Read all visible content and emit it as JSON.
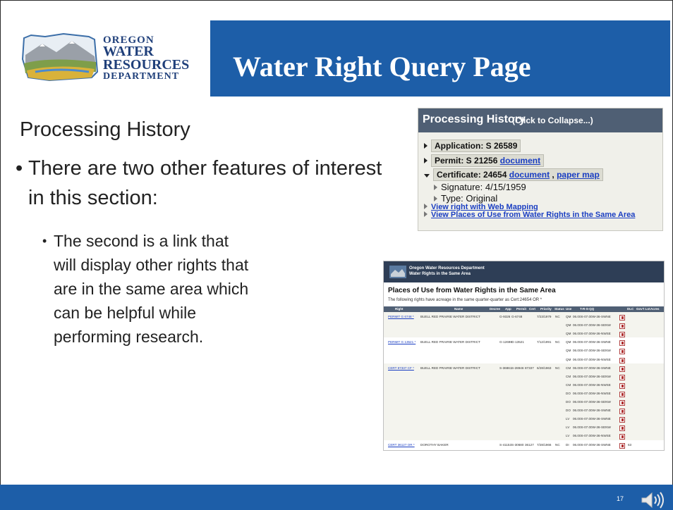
{
  "logo": {
    "line1": "OREGON",
    "line2": "WATER",
    "line3": "RESOURCES",
    "line4": "DEPARTMENT"
  },
  "header": {
    "title": "Water Right Query Page"
  },
  "content": {
    "section_title": "Processing History",
    "bullet1": "There are two other features of interest in this section:",
    "bullet2": "The second is a link that will display other rights that are in the same area which can be helpful while performing research."
  },
  "processing_history": {
    "title": "Processing History",
    "collapse": "(Click to Collapse...)",
    "application": "Application: S 26589",
    "permit": "Permit: S 21256",
    "document_link": "document",
    "certificate": "Certificate: 24654",
    "paper_map_link": "paper map",
    "signature": "Signature: 4/15/1959",
    "type": "Type: Original",
    "web_mapping_link": "View right with Web Mapping",
    "places_link": "View Places of Use from Water Rights in the Same Area"
  },
  "places": {
    "dept_line1": "Oregon Water Resources Department",
    "dept_line2": "Water Rights in the Same Area",
    "title": "Places of Use from Water Rights in the Same Area",
    "subtitle": "The following rights have acreage in the same quarter-quarter as Cert:24654 OR *",
    "columns": [
      "Right",
      "Name",
      "Decree",
      "App",
      "Permit",
      "Cert",
      "Priority",
      "Status",
      "Use",
      "T-R-S-QQ",
      "DLC",
      "Gov't Lot",
      "Acres"
    ],
    "rows": [
      {
        "right": "PERMIT G 6748 *",
        "name": "BUELL RED PRAIRIE WATER DISTRICT",
        "app": "G-9326",
        "permit": "G-6748",
        "cert": "",
        "priority": "7/23/1979",
        "status": "NC",
        "use": "QM",
        "trs": "06.00S-07.00W-36-SWNE",
        "acres": ""
      },
      {
        "right": "",
        "name": "",
        "app": "",
        "permit": "",
        "cert": "",
        "priority": "",
        "status": "",
        "use": "QM",
        "trs": "06.00S-07.00W-36-SENW",
        "acres": ""
      },
      {
        "right": "",
        "name": "",
        "app": "",
        "permit": "",
        "cert": "",
        "priority": "",
        "status": "",
        "use": "QM",
        "trs": "06.00S-07.00W-36-NWSE",
        "acres": ""
      },
      {
        "right": "PERMIT G 13521 *",
        "name": "BUELL RED PRAIRIE WATER DISTRICT",
        "app": "G-12698",
        "permit": "G-13521",
        "cert": "",
        "priority": "7/12/1991",
        "status": "NC",
        "use": "QM",
        "trs": "06.00S-07.00W-36-SWNE",
        "acres": ""
      },
      {
        "right": "",
        "name": "",
        "app": "",
        "permit": "",
        "cert": "",
        "priority": "",
        "status": "",
        "use": "QM",
        "trs": "06.00S-07.00W-36-SENW",
        "acres": ""
      },
      {
        "right": "",
        "name": "",
        "app": "",
        "permit": "",
        "cert": "",
        "priority": "",
        "status": "",
        "use": "QM",
        "trs": "06.00S-07.00W-36-NWSE",
        "acres": ""
      },
      {
        "right": "CERT 87337 CF *",
        "name": "BUELL RED PRAIRIE WATER DISTRICT",
        "app": "S-36861",
        "permit": "S-28946",
        "cert": "87337",
        "priority": "6/28/1963",
        "status": "NC",
        "use": "CM",
        "trs": "06.00S-07.00W-36-SWNE",
        "acres": ""
      },
      {
        "right": "",
        "name": "",
        "app": "",
        "permit": "",
        "cert": "",
        "priority": "",
        "status": "",
        "use": "CM",
        "trs": "06.00S-07.00W-36-SENW",
        "acres": ""
      },
      {
        "right": "",
        "name": "",
        "app": "",
        "permit": "",
        "cert": "",
        "priority": "",
        "status": "",
        "use": "CM",
        "trs": "06.00S-07.00W-36-NWSE",
        "acres": ""
      },
      {
        "right": "",
        "name": "",
        "app": "",
        "permit": "",
        "cert": "",
        "priority": "",
        "status": "",
        "use": "DO",
        "trs": "06.00S-07.00W-36-NWSE",
        "acres": ""
      },
      {
        "right": "",
        "name": "",
        "app": "",
        "permit": "",
        "cert": "",
        "priority": "",
        "status": "",
        "use": "DO",
        "trs": "06.00S-07.00W-36-SENW",
        "acres": ""
      },
      {
        "right": "",
        "name": "",
        "app": "",
        "permit": "",
        "cert": "",
        "priority": "",
        "status": "",
        "use": "DO",
        "trs": "06.00S-07.00W-36-SWNE",
        "acres": ""
      },
      {
        "right": "",
        "name": "",
        "app": "",
        "permit": "",
        "cert": "",
        "priority": "",
        "status": "",
        "use": "LV",
        "trs": "06.00S-07.00W-36-SWNE",
        "acres": ""
      },
      {
        "right": "",
        "name": "",
        "app": "",
        "permit": "",
        "cert": "",
        "priority": "",
        "status": "",
        "use": "LV",
        "trs": "06.00S-07.00W-36-SENW",
        "acres": ""
      },
      {
        "right": "",
        "name": "",
        "app": "",
        "permit": "",
        "cert": "",
        "priority": "",
        "status": "",
        "use": "LV",
        "trs": "06.00S-07.00W-36-NWSE",
        "acres": ""
      },
      {
        "right": "CERT 36127 OR *",
        "name": "DOROTHY BAKER",
        "app": "S-41153",
        "permit": "S-30680",
        "cert": "36127",
        "priority": "7/28/1966",
        "status": "NC",
        "use": "DI",
        "trs": "06.00S-07.00W-36-SWNE",
        "acres": "63"
      }
    ]
  },
  "footer": {
    "page_number": "17"
  }
}
